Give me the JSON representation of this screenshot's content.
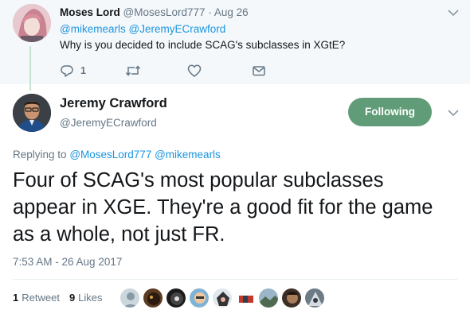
{
  "parent_tweet": {
    "author_name": "Moses Lord",
    "author_handle": "@MosesLord777",
    "separator": "·",
    "date": "Aug 26",
    "mentions": [
      "@mikemearls",
      "@JeremyECrawford"
    ],
    "text": "Why is you decided to include SCAG's subclasses in XGtE?",
    "reply_count": "1",
    "icons": [
      "reply-icon",
      "retweet-icon",
      "like-icon",
      "direct-message-icon",
      "chevron-down-icon"
    ]
  },
  "main_tweet": {
    "author_name": "Jeremy Crawford",
    "author_handle": "@JeremyECrawford",
    "follow_label": "Following",
    "replying_label": "Replying to",
    "replying_mentions": [
      "@MosesLord777",
      "@mikemearls"
    ],
    "text": "Four of SCAG's most popular subclasses appear in XGE. They're a good fit for the game as a whole, not just FR.",
    "timestamp": "7:53 AM - 26 Aug 2017",
    "retweet_count": "1",
    "retweet_label": "Retweet",
    "like_count": "9",
    "like_label": "Likes",
    "liker_avatar_count": 9
  },
  "colors": {
    "follow_button": "#5f9c77",
    "link": "#1b95e0",
    "muted": "#657786",
    "thread_line": "#c6e3d4",
    "parent_background": "#f5f8fa"
  }
}
